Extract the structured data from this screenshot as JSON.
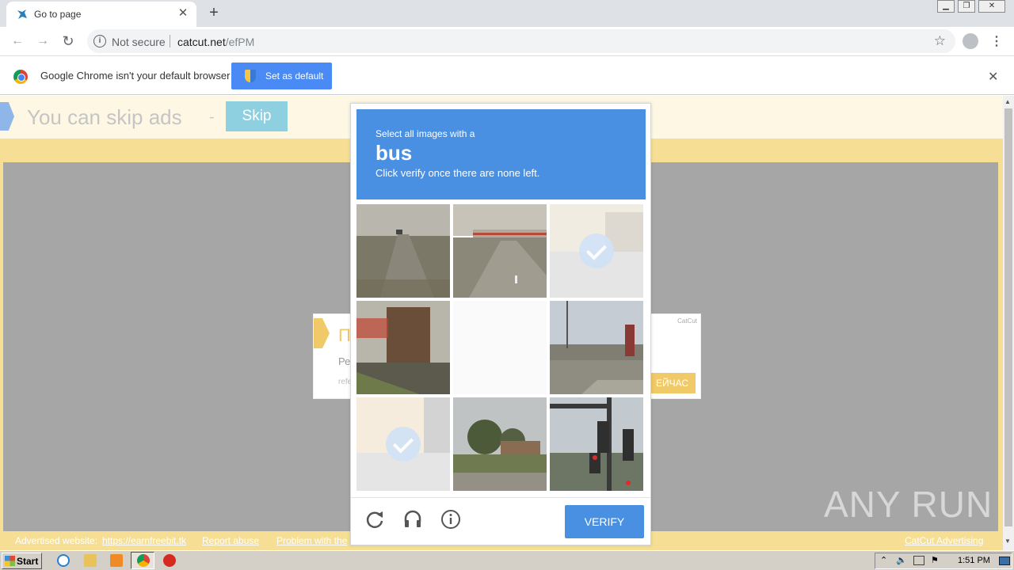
{
  "browser": {
    "tab_title": "Go to page",
    "url_security": "Not secure",
    "url_host": "catcut.net",
    "url_path": "/efPM",
    "window_controls": [
      "minimize",
      "restore",
      "close"
    ]
  },
  "infobar": {
    "message": "Google Chrome isn't your default browser",
    "set_default_label": "Set as default"
  },
  "page": {
    "skip_text": "You can skip ads",
    "skip_dash": "-",
    "skip_button": "Skip",
    "ad_title": "П",
    "ad_line2": "Ре",
    "ad_line3": "refe",
    "ad_brand": "CatCut",
    "ad_cta": "ЕЙЧАС",
    "footer": {
      "advertised_label": "Advertised website:",
      "advertised_link": "https://earnfreebit.tk",
      "report_abuse": "Report abuse",
      "problem": "Problem with the",
      "brand": "CatCut Advertising"
    }
  },
  "captcha": {
    "instruction": "Select all images with a",
    "target": "bus",
    "subtext": "Click verify once there are none left.",
    "verify_label": "VERIFY",
    "tiles": [
      {
        "state": "image",
        "scene": "highway"
      },
      {
        "state": "image",
        "scene": "overpass"
      },
      {
        "state": "selected-fading",
        "scene": "store"
      },
      {
        "state": "image",
        "scene": "building"
      },
      {
        "state": "blank",
        "scene": ""
      },
      {
        "state": "image",
        "scene": "intersection"
      },
      {
        "state": "selected-fading",
        "scene": "shop"
      },
      {
        "state": "image",
        "scene": "trees"
      },
      {
        "state": "image",
        "scene": "traffic-light"
      }
    ]
  },
  "watermark": "ANY RUN",
  "taskbar": {
    "start_label": "Start",
    "clock": "1:51 PM"
  },
  "colors": {
    "captcha_blue": "#4a90e2",
    "page_yellow": "#f6df94",
    "chrome_blue": "#4a8af4"
  }
}
